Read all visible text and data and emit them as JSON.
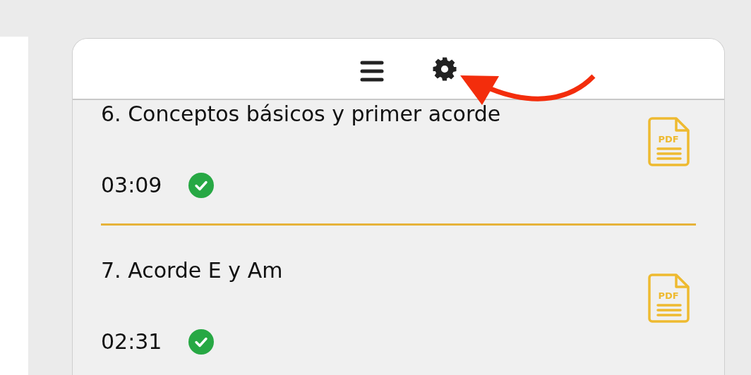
{
  "lessons": [
    {
      "title": "6. Conceptos básicos y primer acorde",
      "duration": "03:09",
      "completed": true,
      "attachment_label": "PDF"
    },
    {
      "title": "7. Acorde E y Am",
      "duration": "02:31",
      "completed": true,
      "attachment_label": "PDF"
    }
  ]
}
